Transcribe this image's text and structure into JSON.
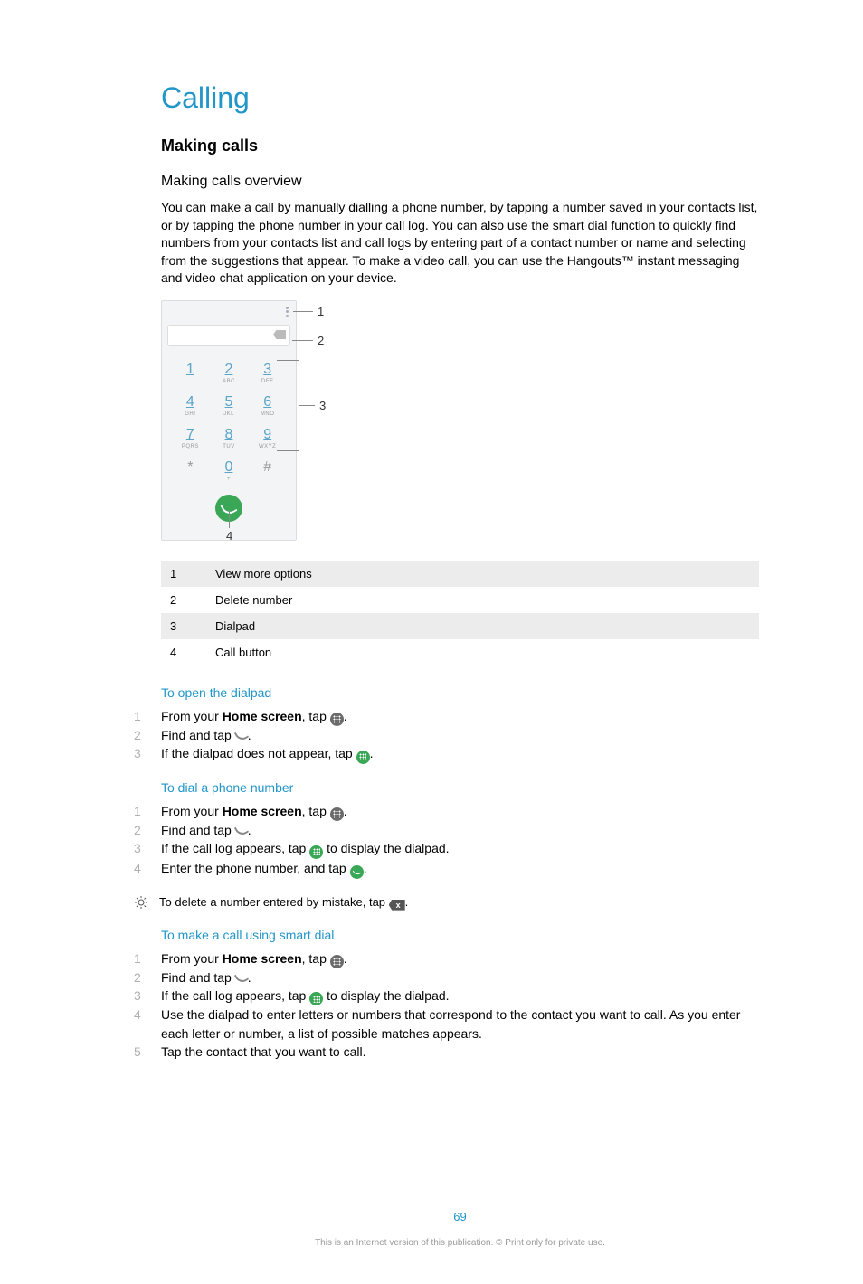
{
  "title": "Calling",
  "section": "Making calls",
  "subsection": "Making calls overview",
  "overview_body": "You can make a call by manually dialling a phone number, by tapping a number saved in your contacts list, or by tapping the phone number in your call log. You can also use the smart dial function to quickly find numbers from your contacts list and call logs by entering part of a contact number or name and selecting from the suggestions that appear. To make a video call, you can use the Hangouts™ instant messaging and video chat application on your device.",
  "callouts": {
    "c1": "1",
    "c2": "2",
    "c3": "3",
    "c4": "4"
  },
  "legend": [
    {
      "num": "1",
      "label": "View more options"
    },
    {
      "num": "2",
      "label": "Delete number"
    },
    {
      "num": "3",
      "label": "Dialpad"
    },
    {
      "num": "4",
      "label": "Call button"
    }
  ],
  "keypad": [
    {
      "n": "1",
      "s": ""
    },
    {
      "n": "2",
      "s": "ABC"
    },
    {
      "n": "3",
      "s": "DEF"
    },
    {
      "n": "4",
      "s": "GHI"
    },
    {
      "n": "5",
      "s": "JKL"
    },
    {
      "n": "6",
      "s": "MNO"
    },
    {
      "n": "7",
      "s": "PQRS"
    },
    {
      "n": "8",
      "s": "TUV"
    },
    {
      "n": "9",
      "s": "WXYZ"
    },
    {
      "n": "*",
      "s": ""
    },
    {
      "n": "0",
      "s": "+"
    },
    {
      "n": "#",
      "s": ""
    }
  ],
  "proc1": {
    "title": "To open the dialpad",
    "s1a": "From your ",
    "s1b": "Home screen",
    "s1c": ", tap ",
    "s1d": ".",
    "s2a": "Find and tap ",
    "s2b": ".",
    "s3a": "If the dialpad does not appear, tap ",
    "s3b": "."
  },
  "proc2": {
    "title": "To dial a phone number",
    "s1a": "From your ",
    "s1b": "Home screen",
    "s1c": ", tap ",
    "s1d": ".",
    "s2a": "Find and tap ",
    "s2b": ".",
    "s3a": "If the call log appears, tap ",
    "s3b": " to display the dialpad.",
    "s4a": "Enter the phone number, and tap ",
    "s4b": "."
  },
  "tip": {
    "a": "To delete a number entered by mistake, tap ",
    "b": ".",
    "del_glyph": "x"
  },
  "proc3": {
    "title": "To make a call using smart dial",
    "s1a": "From your ",
    "s1b": "Home screen",
    "s1c": ", tap ",
    "s1d": ".",
    "s2a": "Find and tap ",
    "s2b": ".",
    "s3a": "If the call log appears, tap ",
    "s3b": " to display the dialpad.",
    "s4": "Use the dialpad to enter letters or numbers that correspond to the contact you want to call. As you enter each letter or number, a list of possible matches appears.",
    "s5": "Tap the contact that you want to call."
  },
  "footer": {
    "page": "69",
    "copyright": "This is an Internet version of this publication. © Print only for private use."
  }
}
